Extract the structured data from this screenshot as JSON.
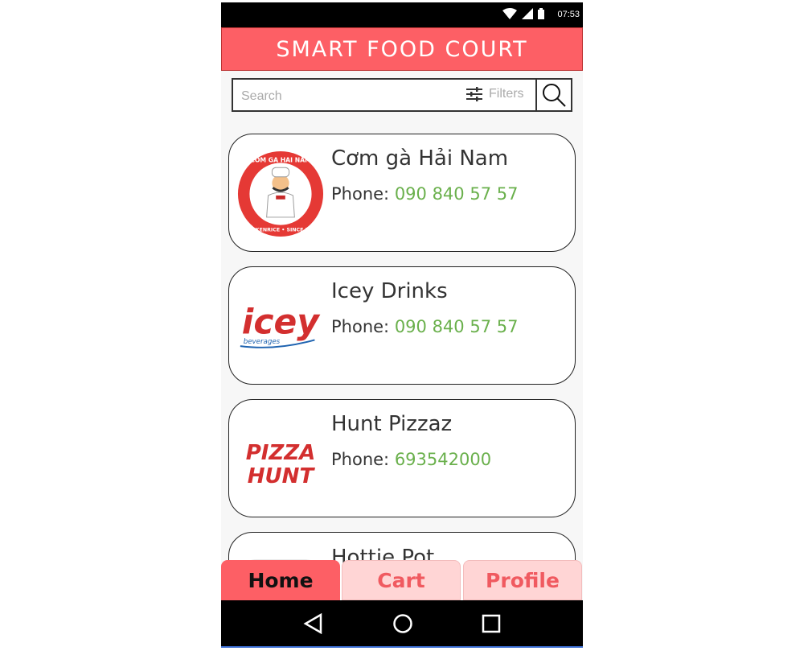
{
  "status": {
    "time": "07:53"
  },
  "header": {
    "title": "SMART FOOD COURT"
  },
  "search": {
    "placeholder": "Search",
    "filters_label": "Filters"
  },
  "restaurants": [
    {
      "name": "Cơm gà Hải Nam",
      "phone_label": "Phone: ",
      "phone": "090 840 57 57",
      "logo": "com-ga-hai-nam-logo",
      "logo_text_top": "COM GA HAI NAM",
      "logo_text_bottom": "CHICKENRICE • SINCE 2017"
    },
    {
      "name": "Icey Drinks",
      "phone_label": "Phone: ",
      "phone": "090 840 57 57",
      "logo": "icey-logo",
      "logo_text": "icey",
      "logo_subtext": "beverages"
    },
    {
      "name": "Hunt Pizzaz",
      "phone_label": "Phone: ",
      "phone": "693542000",
      "logo": "pizza-hunt-logo",
      "logo_line1": "PIZZA",
      "logo_line2": "HUNT"
    },
    {
      "name": "Hottie Pot",
      "logo": "hottie-pot-logo"
    }
  ],
  "tabs": [
    {
      "label": "Home",
      "active": true
    },
    {
      "label": "Cart",
      "active": false
    },
    {
      "label": "Profile",
      "active": false
    }
  ],
  "colors": {
    "accent": "#fd5f65",
    "phone_green": "#6ab04c",
    "tab_inactive_bg": "#ffd5d5"
  }
}
